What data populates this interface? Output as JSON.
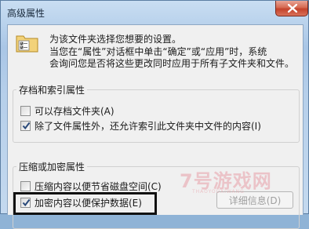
{
  "window": {
    "title": "高级属性"
  },
  "description": {
    "line1": "为该文件夹选择您想要的设置。",
    "line2": "当您在“属性”对话框中单击“确定”或“应用”时，系统",
    "line3": "会询问您是否将这些更改同时应用于所有子文件夹和文件。"
  },
  "archive_group": {
    "label": "存档和索引属性",
    "options": [
      {
        "label": "可以存档文件夹(A)",
        "checked": false
      },
      {
        "label": "除了文件属性外，还允许索引此文件夹中文件的内容(I)",
        "checked": true
      }
    ]
  },
  "compress_group": {
    "label": "压缩或加密属性",
    "options": [
      {
        "label": "压缩内容以便节省磁盘空间(C)",
        "checked": false
      },
      {
        "label": "加密内容以便保护数据(E)",
        "checked": true
      }
    ],
    "details_button": "详细信息(D)"
  },
  "watermark": {
    "main": "7号游戏网",
    "sub": "THAOYOUXIWANG"
  },
  "colors": {
    "accent": "#2b5d8c",
    "close": "#c4422b",
    "highlight": "#111111"
  }
}
